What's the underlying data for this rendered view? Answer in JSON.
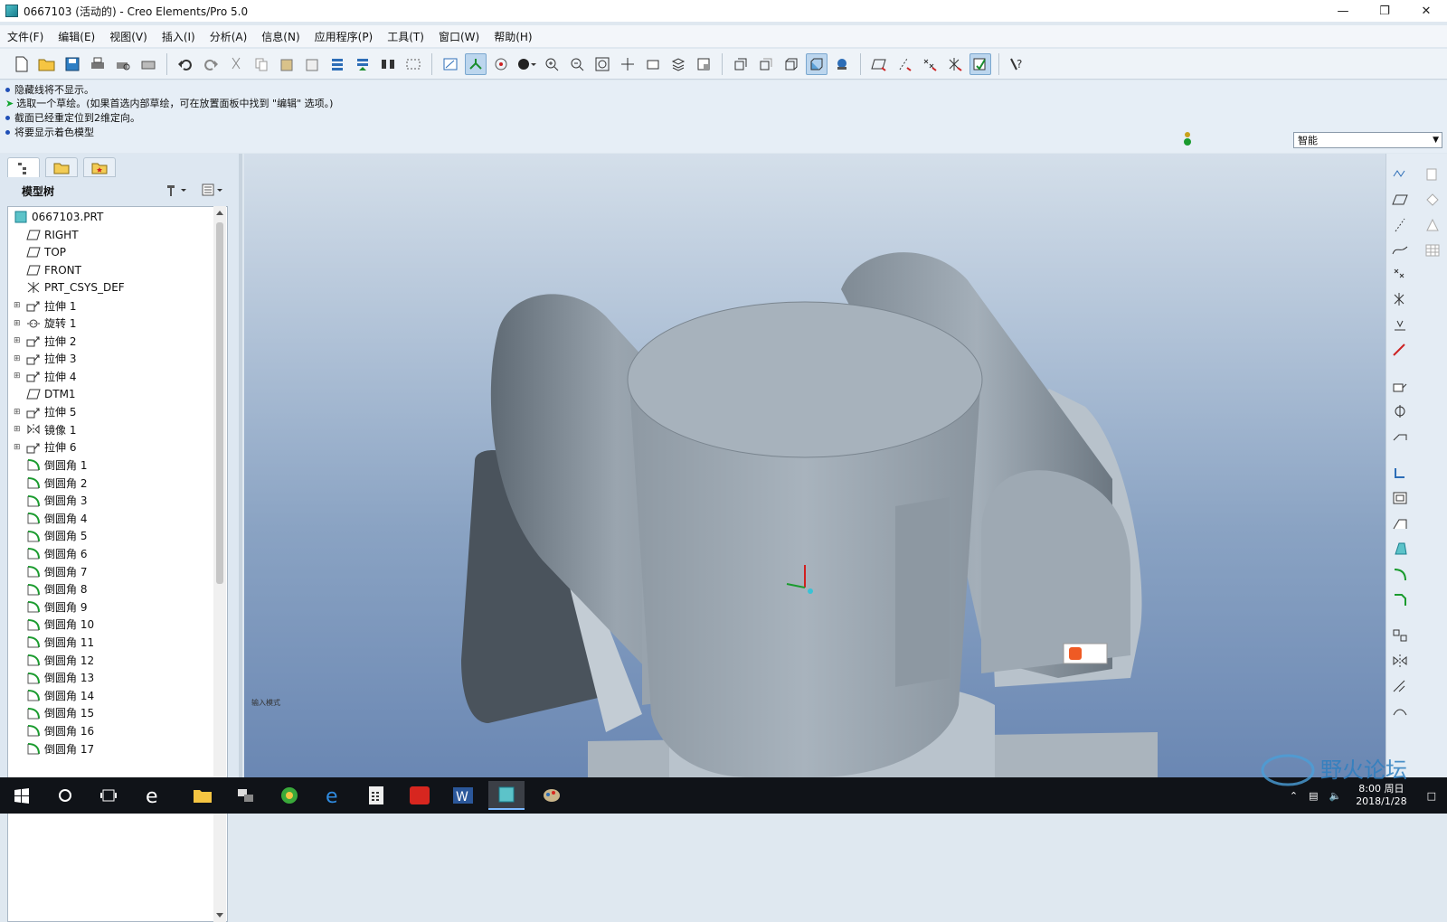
{
  "window": {
    "title": "0667103 (活动的) - Creo Elements/Pro 5.0",
    "controls": [
      "minimize-icon",
      "restore-icon",
      "close-icon"
    ]
  },
  "menu": [
    "文件(F)",
    "编辑(E)",
    "视图(V)",
    "插入(I)",
    "分析(A)",
    "信息(N)",
    "应用程序(P)",
    "工具(T)",
    "窗口(W)",
    "帮助(H)"
  ],
  "messages": [
    {
      "text": "隐藏线将不显示。",
      "kind": "info"
    },
    {
      "text": "选取一个草绘。(如果首选内部草绘，可在放置面板中找到 \"编辑\" 选项。)",
      "kind": "prompt"
    },
    {
      "text": "截面已经重定位到2维定向。",
      "kind": "info"
    },
    {
      "text": "将要显示着色模型",
      "kind": "info"
    }
  ],
  "selection_filter": {
    "value": "智能"
  },
  "tree": {
    "header": "模型树",
    "items": [
      {
        "label": "0667103.PRT",
        "icon": "part-icon",
        "expand": false,
        "indent": 0
      },
      {
        "label": "RIGHT",
        "icon": "datum-plane-icon",
        "expand": false,
        "indent": 1
      },
      {
        "label": "TOP",
        "icon": "datum-plane-icon",
        "expand": false,
        "indent": 1
      },
      {
        "label": "FRONT",
        "icon": "datum-plane-icon",
        "expand": false,
        "indent": 1
      },
      {
        "label": "PRT_CSYS_DEF",
        "icon": "csys-icon",
        "expand": false,
        "indent": 1
      },
      {
        "label": "拉伸 1",
        "icon": "extrude-icon",
        "expand": true,
        "indent": 1
      },
      {
        "label": "旋转 1",
        "icon": "revolve-icon",
        "expand": true,
        "indent": 1
      },
      {
        "label": "拉伸 2",
        "icon": "extrude-icon",
        "expand": true,
        "indent": 1
      },
      {
        "label": "拉伸 3",
        "icon": "extrude-icon",
        "expand": true,
        "indent": 1
      },
      {
        "label": "拉伸 4",
        "icon": "extrude-icon",
        "expand": true,
        "indent": 1
      },
      {
        "label": "DTM1",
        "icon": "datum-plane-icon",
        "expand": false,
        "indent": 1
      },
      {
        "label": "拉伸 5",
        "icon": "extrude-icon",
        "expand": true,
        "indent": 1
      },
      {
        "label": "镜像 1",
        "icon": "mirror-icon",
        "expand": true,
        "indent": 1
      },
      {
        "label": "拉伸 6",
        "icon": "extrude-icon",
        "expand": true,
        "indent": 1
      },
      {
        "label": "倒圆角 1",
        "icon": "round-icon",
        "expand": false,
        "indent": 1
      },
      {
        "label": "倒圆角 2",
        "icon": "round-icon",
        "expand": false,
        "indent": 1
      },
      {
        "label": "倒圆角 3",
        "icon": "round-icon",
        "expand": false,
        "indent": 1
      },
      {
        "label": "倒圆角 4",
        "icon": "round-icon",
        "expand": false,
        "indent": 1
      },
      {
        "label": "倒圆角 5",
        "icon": "round-icon",
        "expand": false,
        "indent": 1
      },
      {
        "label": "倒圆角 6",
        "icon": "round-icon",
        "expand": false,
        "indent": 1
      },
      {
        "label": "倒圆角 7",
        "icon": "round-icon",
        "expand": false,
        "indent": 1
      },
      {
        "label": "倒圆角 8",
        "icon": "round-icon",
        "expand": false,
        "indent": 1
      },
      {
        "label": "倒圆角 9",
        "icon": "round-icon",
        "expand": false,
        "indent": 1
      },
      {
        "label": "倒圆角 10",
        "icon": "round-icon",
        "expand": false,
        "indent": 1
      },
      {
        "label": "倒圆角 11",
        "icon": "round-icon",
        "expand": false,
        "indent": 1
      },
      {
        "label": "倒圆角 12",
        "icon": "round-icon",
        "expand": false,
        "indent": 1
      },
      {
        "label": "倒圆角 13",
        "icon": "round-icon",
        "expand": false,
        "indent": 1
      },
      {
        "label": "倒圆角 14",
        "icon": "round-icon",
        "expand": false,
        "indent": 1
      },
      {
        "label": "倒圆角 15",
        "icon": "round-icon",
        "expand": false,
        "indent": 1
      },
      {
        "label": "倒圆角 16",
        "icon": "round-icon",
        "expand": false,
        "indent": 1
      },
      {
        "label": "倒圆角 17",
        "icon": "round-icon",
        "expand": false,
        "indent": 1
      }
    ]
  },
  "viewport": {
    "note": "输入模式"
  },
  "taskbar": {
    "clock_time": "8:00 周日",
    "clock_date": "2018/1/28",
    "watermark": "野火论坛"
  },
  "colors": {
    "model": "#9aa5af",
    "bg_top": "#d4dfea",
    "bg_bottom": "#6a87b3",
    "accent": "#1f4fb7"
  }
}
